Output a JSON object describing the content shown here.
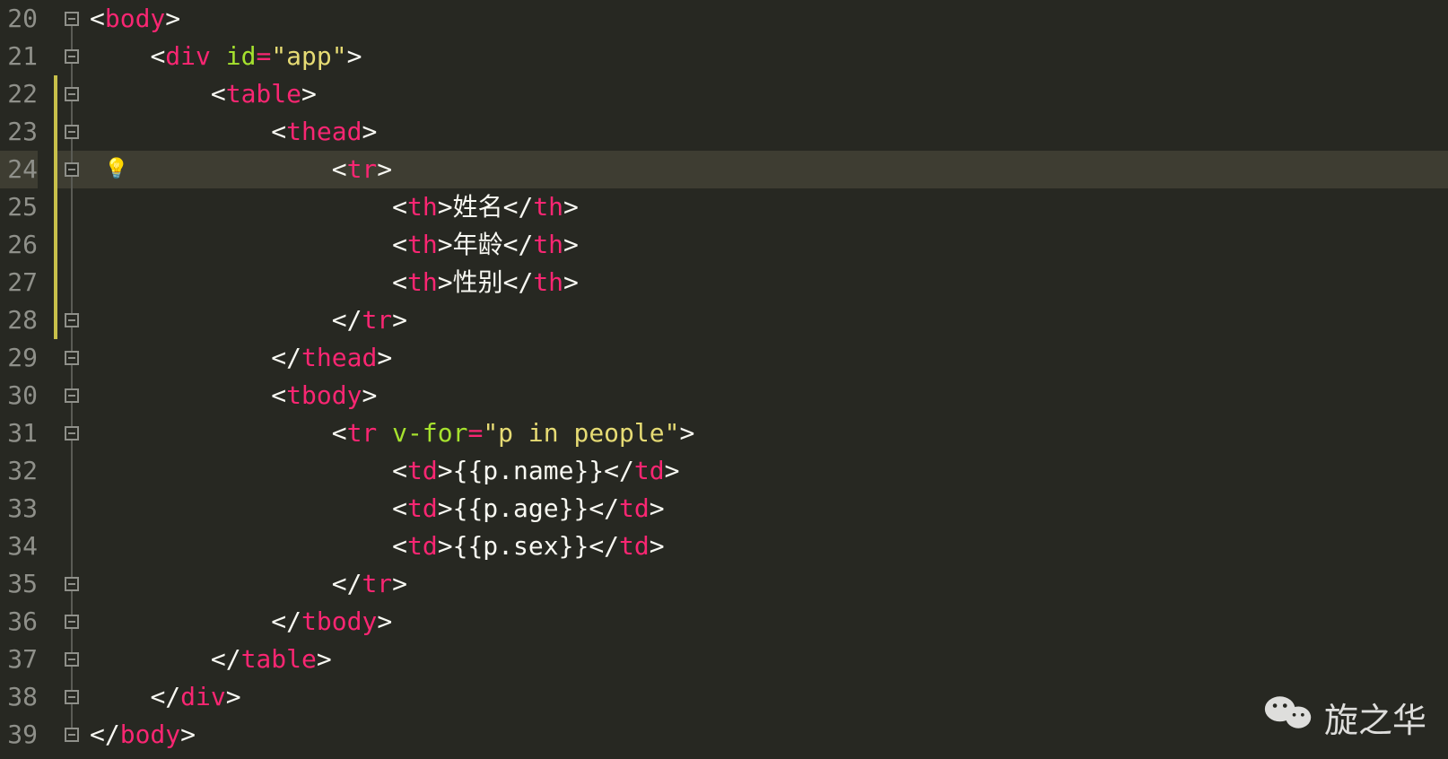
{
  "watermark": "旋之华",
  "lines": [
    {
      "num": "20",
      "indent": 0,
      "fold": "open-start",
      "tokens": [
        {
          "t": "angle",
          "v": "<"
        },
        {
          "t": "tag",
          "v": "body"
        },
        {
          "t": "angle",
          "v": ">"
        }
      ]
    },
    {
      "num": "21",
      "indent": 1,
      "fold": "open-mid",
      "tokens": [
        {
          "t": "angle",
          "v": "<"
        },
        {
          "t": "tag",
          "v": "div"
        },
        {
          "t": "txt",
          "v": " "
        },
        {
          "t": "attr",
          "v": "id"
        },
        {
          "t": "op",
          "v": "="
        },
        {
          "t": "str",
          "v": "\"app\""
        },
        {
          "t": "angle",
          "v": ">"
        }
      ]
    },
    {
      "num": "22",
      "indent": 2,
      "fold": "open-mid",
      "tokens": [
        {
          "t": "angle",
          "v": "<"
        },
        {
          "t": "tag",
          "v": "table"
        },
        {
          "t": "angle",
          "v": ">"
        }
      ]
    },
    {
      "num": "23",
      "indent": 3,
      "fold": "open-mid",
      "tokens": [
        {
          "t": "angle",
          "v": "<"
        },
        {
          "t": "tag",
          "v": "thead"
        },
        {
          "t": "angle",
          "v": ">"
        }
      ]
    },
    {
      "num": "24",
      "indent": 4,
      "fold": "open-mid",
      "current": true,
      "bulb": true,
      "tokens": [
        {
          "t": "angle",
          "v": "<"
        },
        {
          "t": "tag",
          "v": "tr"
        },
        {
          "t": "angle",
          "v": ">"
        }
      ]
    },
    {
      "num": "25",
      "indent": 5,
      "fold": "line",
      "tokens": [
        {
          "t": "angle",
          "v": "<"
        },
        {
          "t": "tag",
          "v": "th"
        },
        {
          "t": "angle",
          "v": ">"
        },
        {
          "t": "txt",
          "v": "姓名"
        },
        {
          "t": "angle",
          "v": "</"
        },
        {
          "t": "tag",
          "v": "th"
        },
        {
          "t": "angle",
          "v": ">"
        }
      ]
    },
    {
      "num": "26",
      "indent": 5,
      "fold": "line",
      "tokens": [
        {
          "t": "angle",
          "v": "<"
        },
        {
          "t": "tag",
          "v": "th"
        },
        {
          "t": "angle",
          "v": ">"
        },
        {
          "t": "txt",
          "v": "年龄"
        },
        {
          "t": "angle",
          "v": "</"
        },
        {
          "t": "tag",
          "v": "th"
        },
        {
          "t": "angle",
          "v": ">"
        }
      ]
    },
    {
      "num": "27",
      "indent": 5,
      "fold": "line",
      "tokens": [
        {
          "t": "angle",
          "v": "<"
        },
        {
          "t": "tag",
          "v": "th"
        },
        {
          "t": "angle",
          "v": ">"
        },
        {
          "t": "txt",
          "v": "性别"
        },
        {
          "t": "angle",
          "v": "</"
        },
        {
          "t": "tag",
          "v": "th"
        },
        {
          "t": "angle",
          "v": ">"
        }
      ]
    },
    {
      "num": "28",
      "indent": 4,
      "fold": "close-mid",
      "tokens": [
        {
          "t": "angle",
          "v": "</"
        },
        {
          "t": "tag",
          "v": "tr"
        },
        {
          "t": "angle",
          "v": ">"
        }
      ]
    },
    {
      "num": "29",
      "indent": 3,
      "fold": "close-mid",
      "tokens": [
        {
          "t": "angle",
          "v": "</"
        },
        {
          "t": "tag",
          "v": "thead"
        },
        {
          "t": "angle",
          "v": ">"
        }
      ]
    },
    {
      "num": "30",
      "indent": 3,
      "fold": "open-mid",
      "tokens": [
        {
          "t": "angle",
          "v": "<"
        },
        {
          "t": "tag",
          "v": "tbody"
        },
        {
          "t": "angle",
          "v": ">"
        }
      ]
    },
    {
      "num": "31",
      "indent": 4,
      "fold": "open-mid",
      "tokens": [
        {
          "t": "angle",
          "v": "<"
        },
        {
          "t": "tag",
          "v": "tr"
        },
        {
          "t": "txt",
          "v": " "
        },
        {
          "t": "attr",
          "v": "v-for"
        },
        {
          "t": "op",
          "v": "="
        },
        {
          "t": "str",
          "v": "\"p in people\""
        },
        {
          "t": "angle",
          "v": ">"
        }
      ]
    },
    {
      "num": "32",
      "indent": 5,
      "fold": "line",
      "tokens": [
        {
          "t": "angle",
          "v": "<"
        },
        {
          "t": "tag",
          "v": "td"
        },
        {
          "t": "angle",
          "v": ">"
        },
        {
          "t": "txt",
          "v": "{{p.name}}"
        },
        {
          "t": "angle",
          "v": "</"
        },
        {
          "t": "tag",
          "v": "td"
        },
        {
          "t": "angle",
          "v": ">"
        }
      ]
    },
    {
      "num": "33",
      "indent": 5,
      "fold": "line",
      "tokens": [
        {
          "t": "angle",
          "v": "<"
        },
        {
          "t": "tag",
          "v": "td"
        },
        {
          "t": "angle",
          "v": ">"
        },
        {
          "t": "txt",
          "v": "{{p.age}}"
        },
        {
          "t": "angle",
          "v": "</"
        },
        {
          "t": "tag",
          "v": "td"
        },
        {
          "t": "angle",
          "v": ">"
        }
      ]
    },
    {
      "num": "34",
      "indent": 5,
      "fold": "line",
      "tokens": [
        {
          "t": "angle",
          "v": "<"
        },
        {
          "t": "tag",
          "v": "td"
        },
        {
          "t": "angle",
          "v": ">"
        },
        {
          "t": "txt",
          "v": "{{p.sex}}"
        },
        {
          "t": "angle",
          "v": "</"
        },
        {
          "t": "tag",
          "v": "td"
        },
        {
          "t": "angle",
          "v": ">"
        }
      ]
    },
    {
      "num": "35",
      "indent": 4,
      "fold": "close-mid",
      "tokens": [
        {
          "t": "angle",
          "v": "</"
        },
        {
          "t": "tag",
          "v": "tr"
        },
        {
          "t": "angle",
          "v": ">"
        }
      ]
    },
    {
      "num": "36",
      "indent": 3,
      "fold": "close-mid",
      "tokens": [
        {
          "t": "angle",
          "v": "</"
        },
        {
          "t": "tag",
          "v": "tbody"
        },
        {
          "t": "angle",
          "v": ">"
        }
      ]
    },
    {
      "num": "37",
      "indent": 2,
      "fold": "close-mid",
      "tokens": [
        {
          "t": "angle",
          "v": "</"
        },
        {
          "t": "tag",
          "v": "table"
        },
        {
          "t": "angle",
          "v": ">"
        }
      ]
    },
    {
      "num": "38",
      "indent": 1,
      "fold": "close-mid",
      "tokens": [
        {
          "t": "angle",
          "v": "</"
        },
        {
          "t": "tag",
          "v": "div"
        },
        {
          "t": "angle",
          "v": ">"
        }
      ]
    },
    {
      "num": "39",
      "indent": 0,
      "fold": "close-end",
      "tokens": [
        {
          "t": "angle",
          "v": "</"
        },
        {
          "t": "tag",
          "v": "body"
        },
        {
          "t": "angle",
          "v": ">"
        }
      ]
    }
  ]
}
